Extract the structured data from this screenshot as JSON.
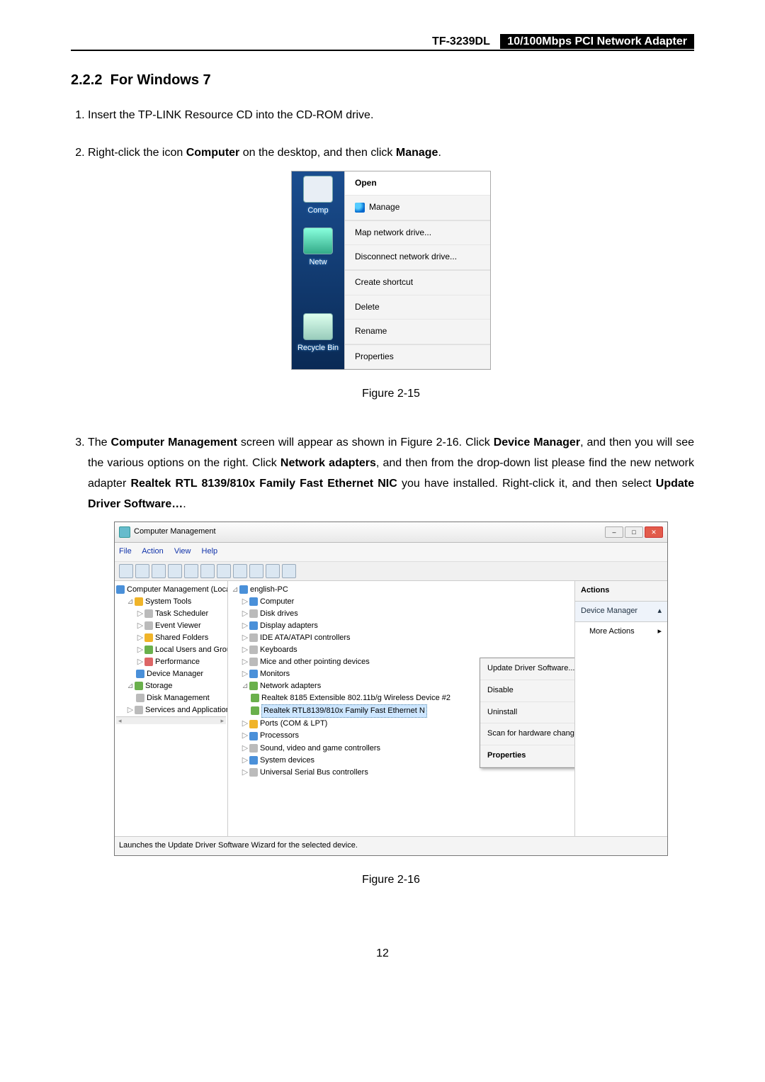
{
  "header": {
    "model": "TF-3239DL",
    "product": "10/100Mbps PCI Network Adapter"
  },
  "section": {
    "num": "2.2.2",
    "title": "For Windows 7"
  },
  "steps": {
    "s1": "Insert the TP-LINK Resource CD into the CD-ROM drive.",
    "s2a": "Right-click the icon ",
    "s2b": "Computer",
    "s2c": " on the desktop, and then click ",
    "s2d": "Manage",
    "s2e": ".",
    "s3a": "The ",
    "s3b": "Computer Management",
    "s3c": " screen will appear as shown in Figure 2-16. Click ",
    "s3d": "Device Manager",
    "s3e": ", and then you will see the various options on the right. Click ",
    "s3f": "Network adapters",
    "s3g": ", and then from the drop-down list please find the new network adapter ",
    "s3h": "Realtek RTL 8139/810x Family Fast Ethernet NIC",
    "s3i": " you have installed. Right-click it, and then select ",
    "s3j": "Update Driver Software…",
    "s3k": "."
  },
  "fig15": {
    "caption": "Figure 2-15",
    "desk": {
      "comp": "Comp",
      "netw": "Netw",
      "recycle": "Recycle Bin"
    },
    "menu": [
      "Open",
      "Manage",
      "Map network drive...",
      "Disconnect network drive...",
      "Create shortcut",
      "Delete",
      "Rename",
      "Properties"
    ]
  },
  "fig16": {
    "caption": "Figure 2-16",
    "title": "Computer Management",
    "menubar": [
      "File",
      "Action",
      "View",
      "Help"
    ],
    "left": {
      "root": "Computer Management (Local",
      "systools": "System Tools",
      "task": "Task Scheduler",
      "event": "Event Viewer",
      "shared": "Shared Folders",
      "local": "Local Users and Groups",
      "perf": "Performance",
      "devmgr": "Device Manager",
      "storage": "Storage",
      "disk": "Disk Management",
      "services": "Services and Applications"
    },
    "center": {
      "root": "english-PC",
      "computer": "Computer",
      "diskdrv": "Disk drives",
      "display": "Display adapters",
      "ide": "IDE ATA/ATAPI controllers",
      "keyb": "Keyboards",
      "mice": "Mice and other pointing devices",
      "mon": "Monitors",
      "net": "Network adapters",
      "nic1": "Realtek 8185 Extensible 802.11b/g Wireless Device #2",
      "nic2": "Realtek RTL8139/810x Family Fast Ethernet N",
      "ports": "Ports (COM & LPT)",
      "proc": "Processors",
      "sound": "Sound, video and game controllers",
      "sysdev": "System devices",
      "usb": "Universal Serial Bus controllers"
    },
    "ctx": [
      "Update Driver Software...",
      "Disable",
      "Uninstall",
      "Scan for hardware changes",
      "Properties"
    ],
    "right": {
      "hdr": "Actions",
      "sub": "Device Manager",
      "item": "More Actions"
    },
    "status": "Launches the Update Driver Software Wizard for the selected device."
  },
  "pagenum": "12"
}
